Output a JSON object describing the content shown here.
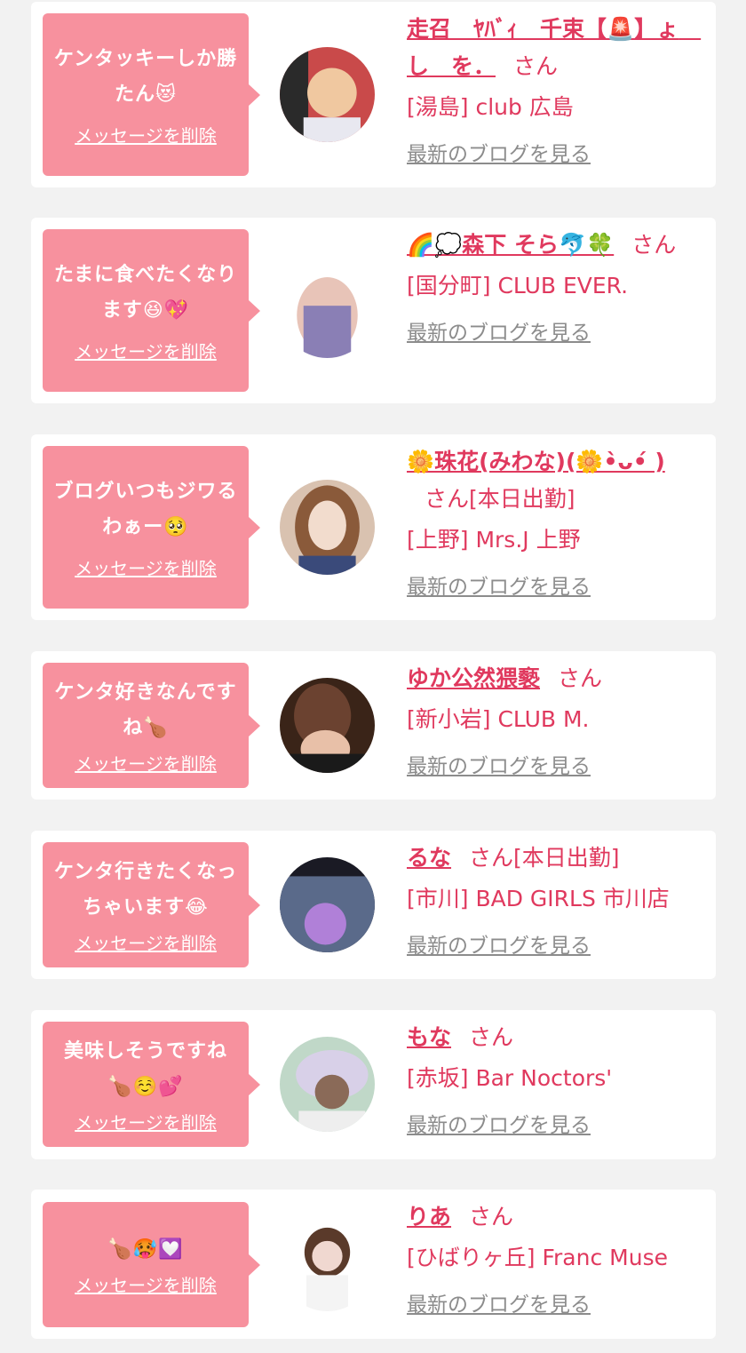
{
  "messages": [
    {
      "message": "ケンタッキーしか勝たん😻",
      "delete_label": "メッセージを削除",
      "name": "走召　ﾔﾊﾞｨ　千束【🚨】ょ　し　を．",
      "honorific": "さん",
      "status": "",
      "shop": "[湯島] club 広島",
      "blog_link": "最新のブログを見る",
      "avatar_colors": [
        "#c94a4a",
        "#f0c8a0",
        "#2a2a2a"
      ]
    },
    {
      "message": "たまに食べたくなります😆💖",
      "delete_label": "メッセージを削除",
      "name": "🌈💭森下 そら🐬🍀",
      "honorific": "さん",
      "status": "",
      "shop": "[国分町] CLUB EVER.",
      "blog_link": "最新のブログを見る",
      "avatar_colors": [
        "#ffffff",
        "#8a7fb5",
        "#e8c4b8"
      ]
    },
    {
      "message": "ブログいつもジワるわぁー🥺",
      "delete_label": "メッセージを削除",
      "name": "🌼珠花(みわな)(🌼•̀ᴗ•́ )",
      "honorific": "さん",
      "status": "[本日出勤]",
      "shop": "[上野] Mrs.J 上野",
      "blog_link": "最新のブログを見る",
      "avatar_colors": [
        "#d9c2b0",
        "#8a5a3a",
        "#f2dccd"
      ]
    },
    {
      "message": "ケンタ好きなんですね🍗",
      "delete_label": "メッセージを削除",
      "name": "ゆか公然猥褻",
      "honorific": "さん",
      "status": "",
      "shop": "[新小岩] CLUB M.",
      "blog_link": "最新のブログを見る",
      "avatar_colors": [
        "#3a2418",
        "#6b4230",
        "#e8c0a8"
      ]
    },
    {
      "message": "ケンタ行きたくなっちゃいます😂",
      "delete_label": "メッセージを削除",
      "name": "るな",
      "honorific": "さん",
      "status": "[本日出勤]",
      "shop": "[市川] BAD GIRLS 市川店",
      "blog_link": "最新のブログを見る",
      "avatar_colors": [
        "#1a1a24",
        "#5a6a8a",
        "#b080d8"
      ]
    },
    {
      "message": "美味しそうですね🍗☺️💕",
      "delete_label": "メッセージを削除",
      "name": "もな",
      "honorific": "さん",
      "status": "",
      "shop": "[赤坂] Bar Noctors'",
      "blog_link": "最新のブログを見る",
      "avatar_colors": [
        "#d8d0e8",
        "#8a6a58",
        "#c0d8c8"
      ]
    },
    {
      "message": "🍗🥵💟",
      "delete_label": "メッセージを削除",
      "name": "りあ",
      "honorific": "さん",
      "status": "",
      "shop": "[ひばりヶ丘] Franc Muse",
      "blog_link": "最新のブログを見る",
      "avatar_colors": [
        "#ffffff",
        "#5a3a2a",
        "#f0d8d0"
      ]
    }
  ]
}
